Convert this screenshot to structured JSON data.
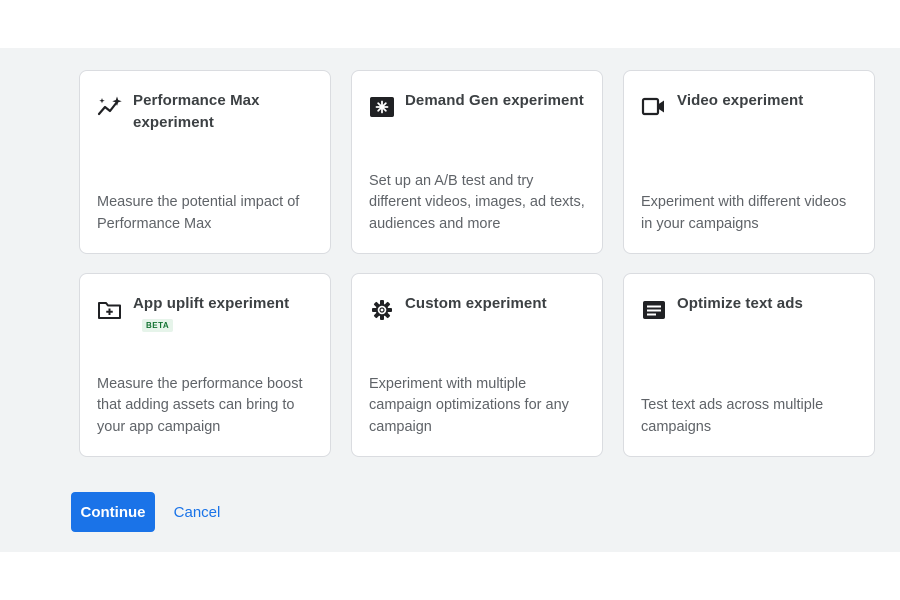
{
  "cards": [
    {
      "title": "Performance Max experiment",
      "description": "Measure the potential impact of Performance Max",
      "icon": "sparkle-trend-icon"
    },
    {
      "title": "Demand Gen experiment",
      "description": "Set up an A/B test and try different videos, images, ad texts, audiences and more",
      "icon": "demand-gen-icon"
    },
    {
      "title": "Video experiment",
      "description": "Experiment with different videos in your campaigns",
      "icon": "video-camera-icon"
    },
    {
      "title": "App uplift experiment",
      "badge": "BETA",
      "description": "Measure the performance boost that adding assets can bring to your app campaign",
      "icon": "folder-add-icon"
    },
    {
      "title": "Custom experiment",
      "description": "Experiment with multiple campaign optimizations for any campaign",
      "icon": "gear-icon"
    },
    {
      "title": "Optimize text ads",
      "description": "Test text ads across multiple campaigns",
      "icon": "text-ad-icon"
    }
  ],
  "actions": {
    "continue_label": "Continue",
    "cancel_label": "Cancel"
  },
  "colors": {
    "primary": "#1a73e8",
    "panel_background": "#f1f3f4",
    "card_border": "#dadce0",
    "badge_text": "#137333",
    "badge_background": "#e6f4ea"
  }
}
